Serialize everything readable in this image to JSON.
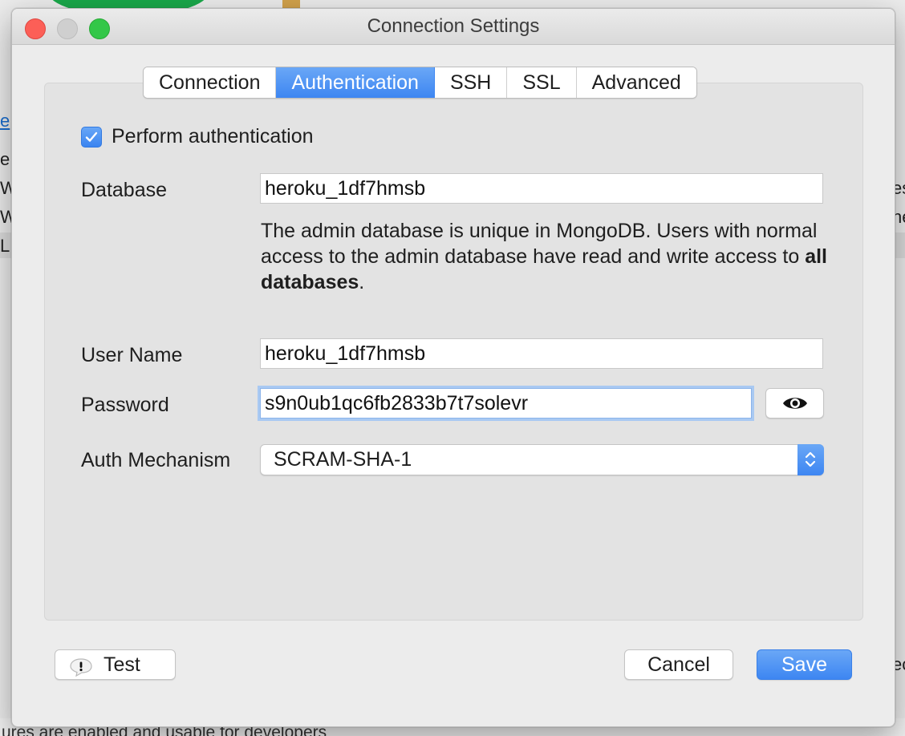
{
  "window": {
    "title": "Connection Settings"
  },
  "background": {
    "link_fragment": "e",
    "row_fragments": [
      "e",
      "W",
      "W",
      "L"
    ],
    "right_fragments": [
      "es",
      "ne"
    ],
    "footer_text": "ures are enabled and usable for developers",
    "right_bottom_fragment": "ec"
  },
  "tabs": [
    {
      "label": "Connection",
      "active": false
    },
    {
      "label": "Authentication",
      "active": true
    },
    {
      "label": "SSH",
      "active": false
    },
    {
      "label": "SSL",
      "active": false
    },
    {
      "label": "Advanced",
      "active": false
    }
  ],
  "auth": {
    "perform_authentication_label": "Perform authentication",
    "perform_authentication_checked": true,
    "database_label": "Database",
    "database_value": "heroku_1df7hmsb",
    "help_text_pre": "The admin database is unique in MongoDB. Users with normal access to the admin database have read and write access to ",
    "help_text_bold": "all databases",
    "help_text_post": ".",
    "username_label": "User Name",
    "username_value": "heroku_1df7hmsb",
    "password_label": "Password",
    "password_value": "s9n0ub1qc6fb2833b7t7solevr",
    "show_password_icon": "eye-icon",
    "mechanism_label": "Auth Mechanism",
    "mechanism_value": "SCRAM-SHA-1"
  },
  "buttons": {
    "test_label": "Test",
    "test_icon": "warning-bubble-icon",
    "cancel_label": "Cancel",
    "save_label": "Save"
  },
  "colors": {
    "accent": "#3d86f2",
    "close": "#fc5f57",
    "maximize": "#33c748"
  }
}
